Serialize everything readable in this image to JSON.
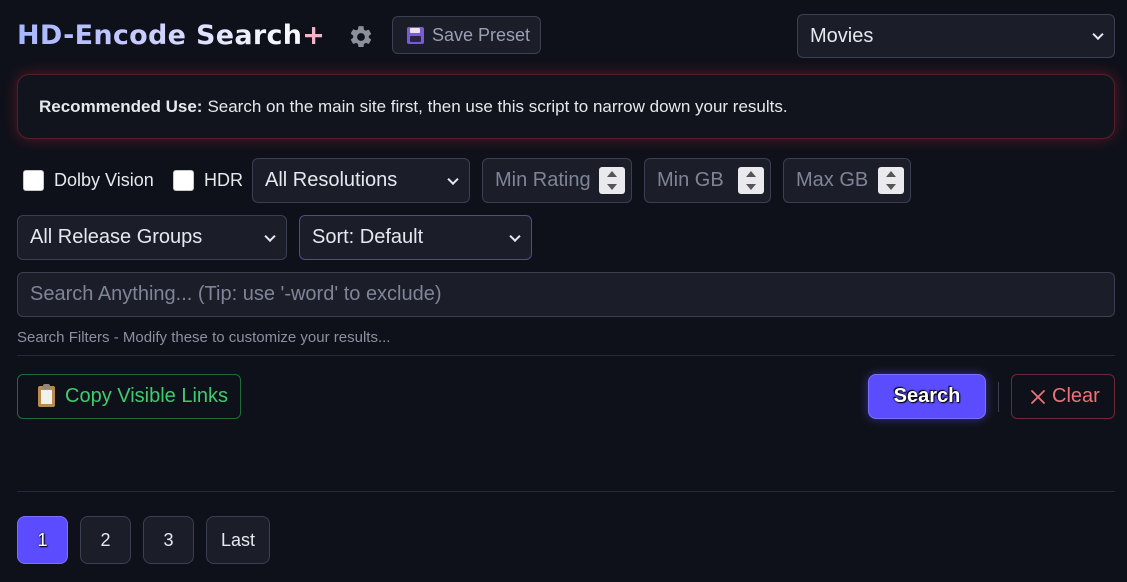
{
  "header": {
    "title": "HD-Encode Search",
    "title_suffix": "+",
    "settings_icon": "gear-icon",
    "save_preset_label": "Save Preset",
    "save_preset_icon": "floppy-disk-icon",
    "category_select": {
      "selected": "Movies"
    }
  },
  "notice": {
    "label": "Recommended Use:",
    "text": "Search on the main site first, then use this script to narrow down your results."
  },
  "filters": {
    "dolby_vision_label": "Dolby Vision",
    "hdr_label": "HDR",
    "resolution": {
      "selected": "All Resolutions"
    },
    "min_rating_placeholder": "Min Rating",
    "min_gb_placeholder": "Min GB",
    "max_gb_placeholder": "Max GB",
    "release_groups": {
      "selected": "All Release Groups"
    },
    "sort": {
      "selected": "Sort: Default"
    }
  },
  "search": {
    "placeholder": "Search Anything... (Tip: use '-word' to exclude)",
    "hint": "Search Filters - Modify these to customize your results..."
  },
  "actions": {
    "copy_label": "Copy Visible Links",
    "copy_icon": "clipboard-icon",
    "search_label": "Search",
    "clear_label": "Clear",
    "clear_icon": "x-icon"
  },
  "pagination": {
    "pages": [
      "1",
      "2",
      "3"
    ],
    "last_label": "Last",
    "active": "1"
  },
  "colors": {
    "background": "#0f111a",
    "accent": "#5b4dff",
    "success": "#3fcb6e",
    "danger": "#f0707a"
  }
}
